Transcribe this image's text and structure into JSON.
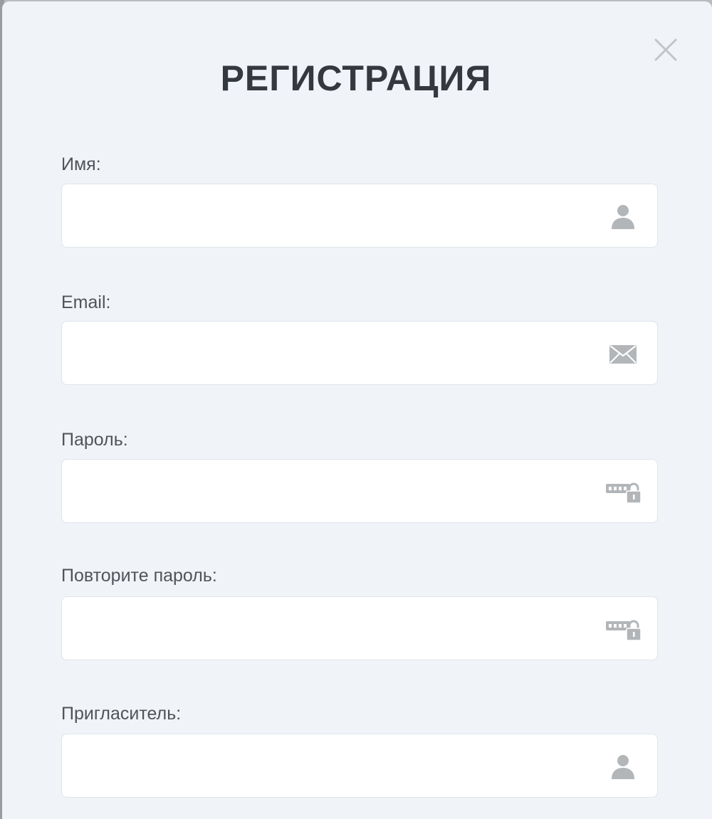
{
  "modal": {
    "title": "РЕГИСТРАЦИЯ",
    "close_icon": "close-icon"
  },
  "fields": [
    {
      "label": "Имя:",
      "value": "",
      "placeholder": "",
      "icon": "user-icon"
    },
    {
      "label": "Email:",
      "value": "",
      "placeholder": "",
      "icon": "envelope-icon"
    },
    {
      "label": "Пароль:",
      "value": "",
      "placeholder": "",
      "icon": "password-lock-icon"
    },
    {
      "label": "Повторите пароль:",
      "value": "",
      "placeholder": "",
      "icon": "password-lock-icon"
    },
    {
      "label": "Пригласитель:",
      "value": "",
      "placeholder": "",
      "icon": "user-icon"
    }
  ],
  "colors": {
    "modal_background": "#f0f4f8",
    "input_background": "#ffffff",
    "title_text": "#35393f",
    "label_text": "#505459",
    "icon": "#b3b6b9"
  }
}
